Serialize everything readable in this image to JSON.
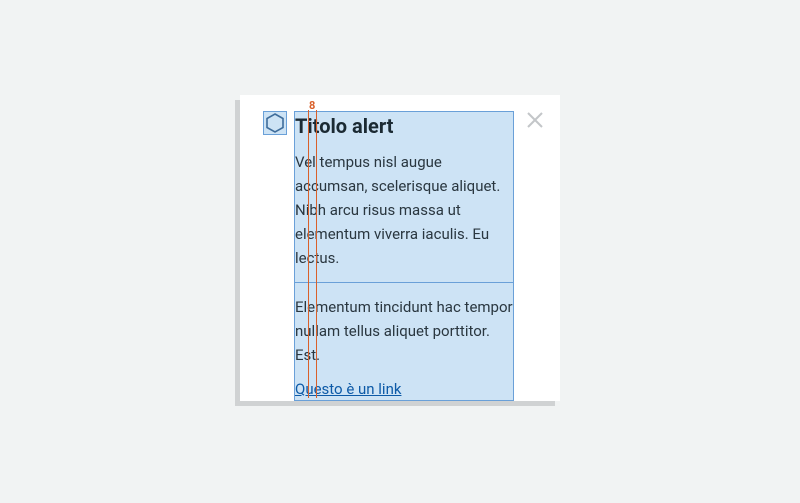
{
  "alert": {
    "title": "Titolo alert",
    "body": "Vel tempus nisl augue accumsan, scelerisque aliquet. Nibh arcu risus massa ut elementum viverra iaculis. Eu lectus.",
    "secondary": "Elementum tincidunt hac tempor nullam tellus aliquet porttitor. Est.",
    "link_label": "Questo è un link"
  },
  "spacing": {
    "value": "8"
  }
}
